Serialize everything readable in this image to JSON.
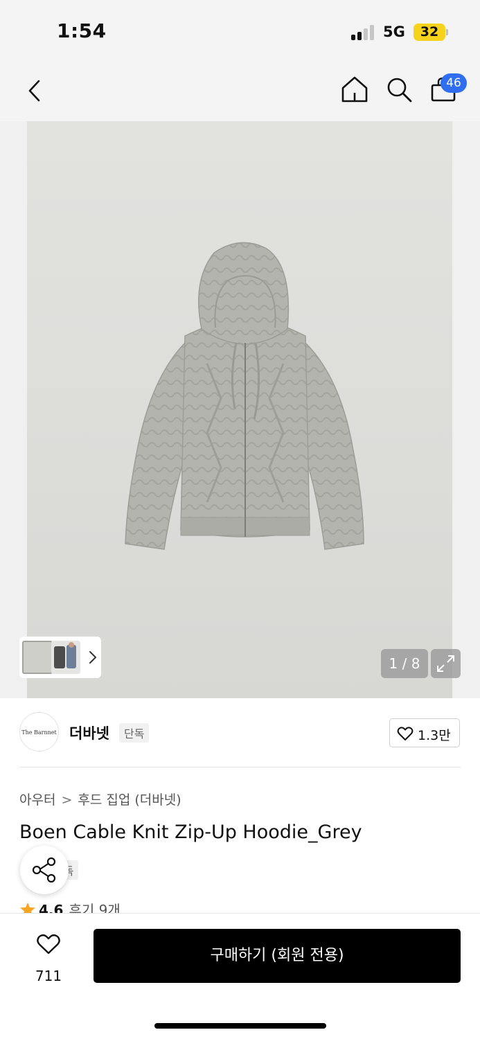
{
  "status_bar": {
    "time": "1:54",
    "network": "5G",
    "battery": "32",
    "battery_color": "#f7d21d"
  },
  "nav": {
    "back_icon": "chevron-left-icon",
    "home_icon": "home-icon",
    "search_icon": "search-icon",
    "bag_icon": "shopping-bag-icon",
    "cart_count": "46",
    "badge_color": "#2f6ef0"
  },
  "gallery": {
    "counter": "1 / 8",
    "current_image": 1,
    "total_images": 8,
    "expand_icon": "expand-icon",
    "thumb_more_icon": "chevron-right-icon"
  },
  "brand": {
    "logo_text": "The Barnnet",
    "name": "더바넷",
    "tag": "단독",
    "like_icon": "heart-outline-icon",
    "like_count": "1.3만"
  },
  "product": {
    "breadcrumb": [
      "아우터",
      "후드 집업 (더바넷)"
    ],
    "breadcrumb_separator": ">",
    "title": "Boen Cable Knit Zip-Up Hoodie_Grey",
    "exclusive_tag": "단독",
    "rating": "4.6",
    "reviews": "후기 9개",
    "star_color": "#f5a623"
  },
  "share": {
    "icon": "share-icon"
  },
  "bottom_bar": {
    "wish_icon": "heart-outline-icon",
    "wish_count": "711",
    "buy_label": "구매하기 (회원 전용)"
  }
}
